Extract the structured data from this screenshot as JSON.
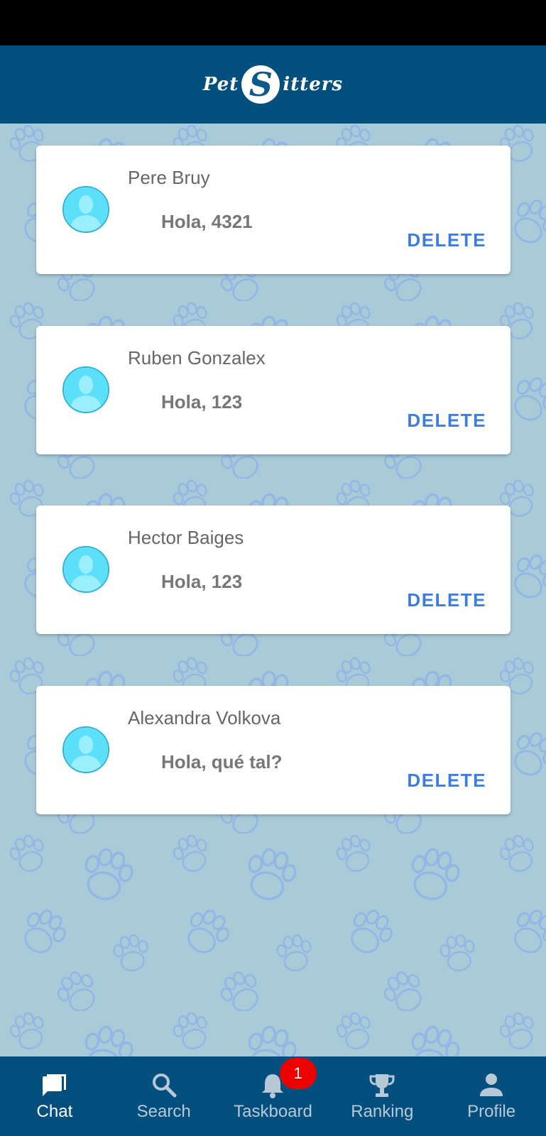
{
  "app": {
    "logo_left": "Pet",
    "logo_badge": "S",
    "logo_right": "itters"
  },
  "chats": [
    {
      "name": "Pere Bruy",
      "message": "Hola, 4321",
      "delete_label": "DELETE"
    },
    {
      "name": "Ruben Gonzalex",
      "message": "Hola, 123",
      "delete_label": "DELETE"
    },
    {
      "name": "Hector Baiges",
      "message": "Hola, 123",
      "delete_label": "DELETE"
    },
    {
      "name": "Alexandra Volkova",
      "message": "Hola, qué tal?",
      "delete_label": "DELETE"
    }
  ],
  "nav": {
    "items": [
      {
        "label": "Chat",
        "icon": "chat-icon",
        "active": true
      },
      {
        "label": "Search",
        "icon": "search-icon"
      },
      {
        "label": "Taskboard",
        "icon": "bell-icon",
        "badge": "1"
      },
      {
        "label": "Ranking",
        "icon": "trophy-icon"
      },
      {
        "label": "Profile",
        "icon": "person-icon"
      }
    ]
  },
  "colors": {
    "header": "#03507e",
    "background": "#a9cbd8",
    "accent": "#3b7de0",
    "badge": "#ee0000",
    "avatar": "#5ce0f9"
  }
}
